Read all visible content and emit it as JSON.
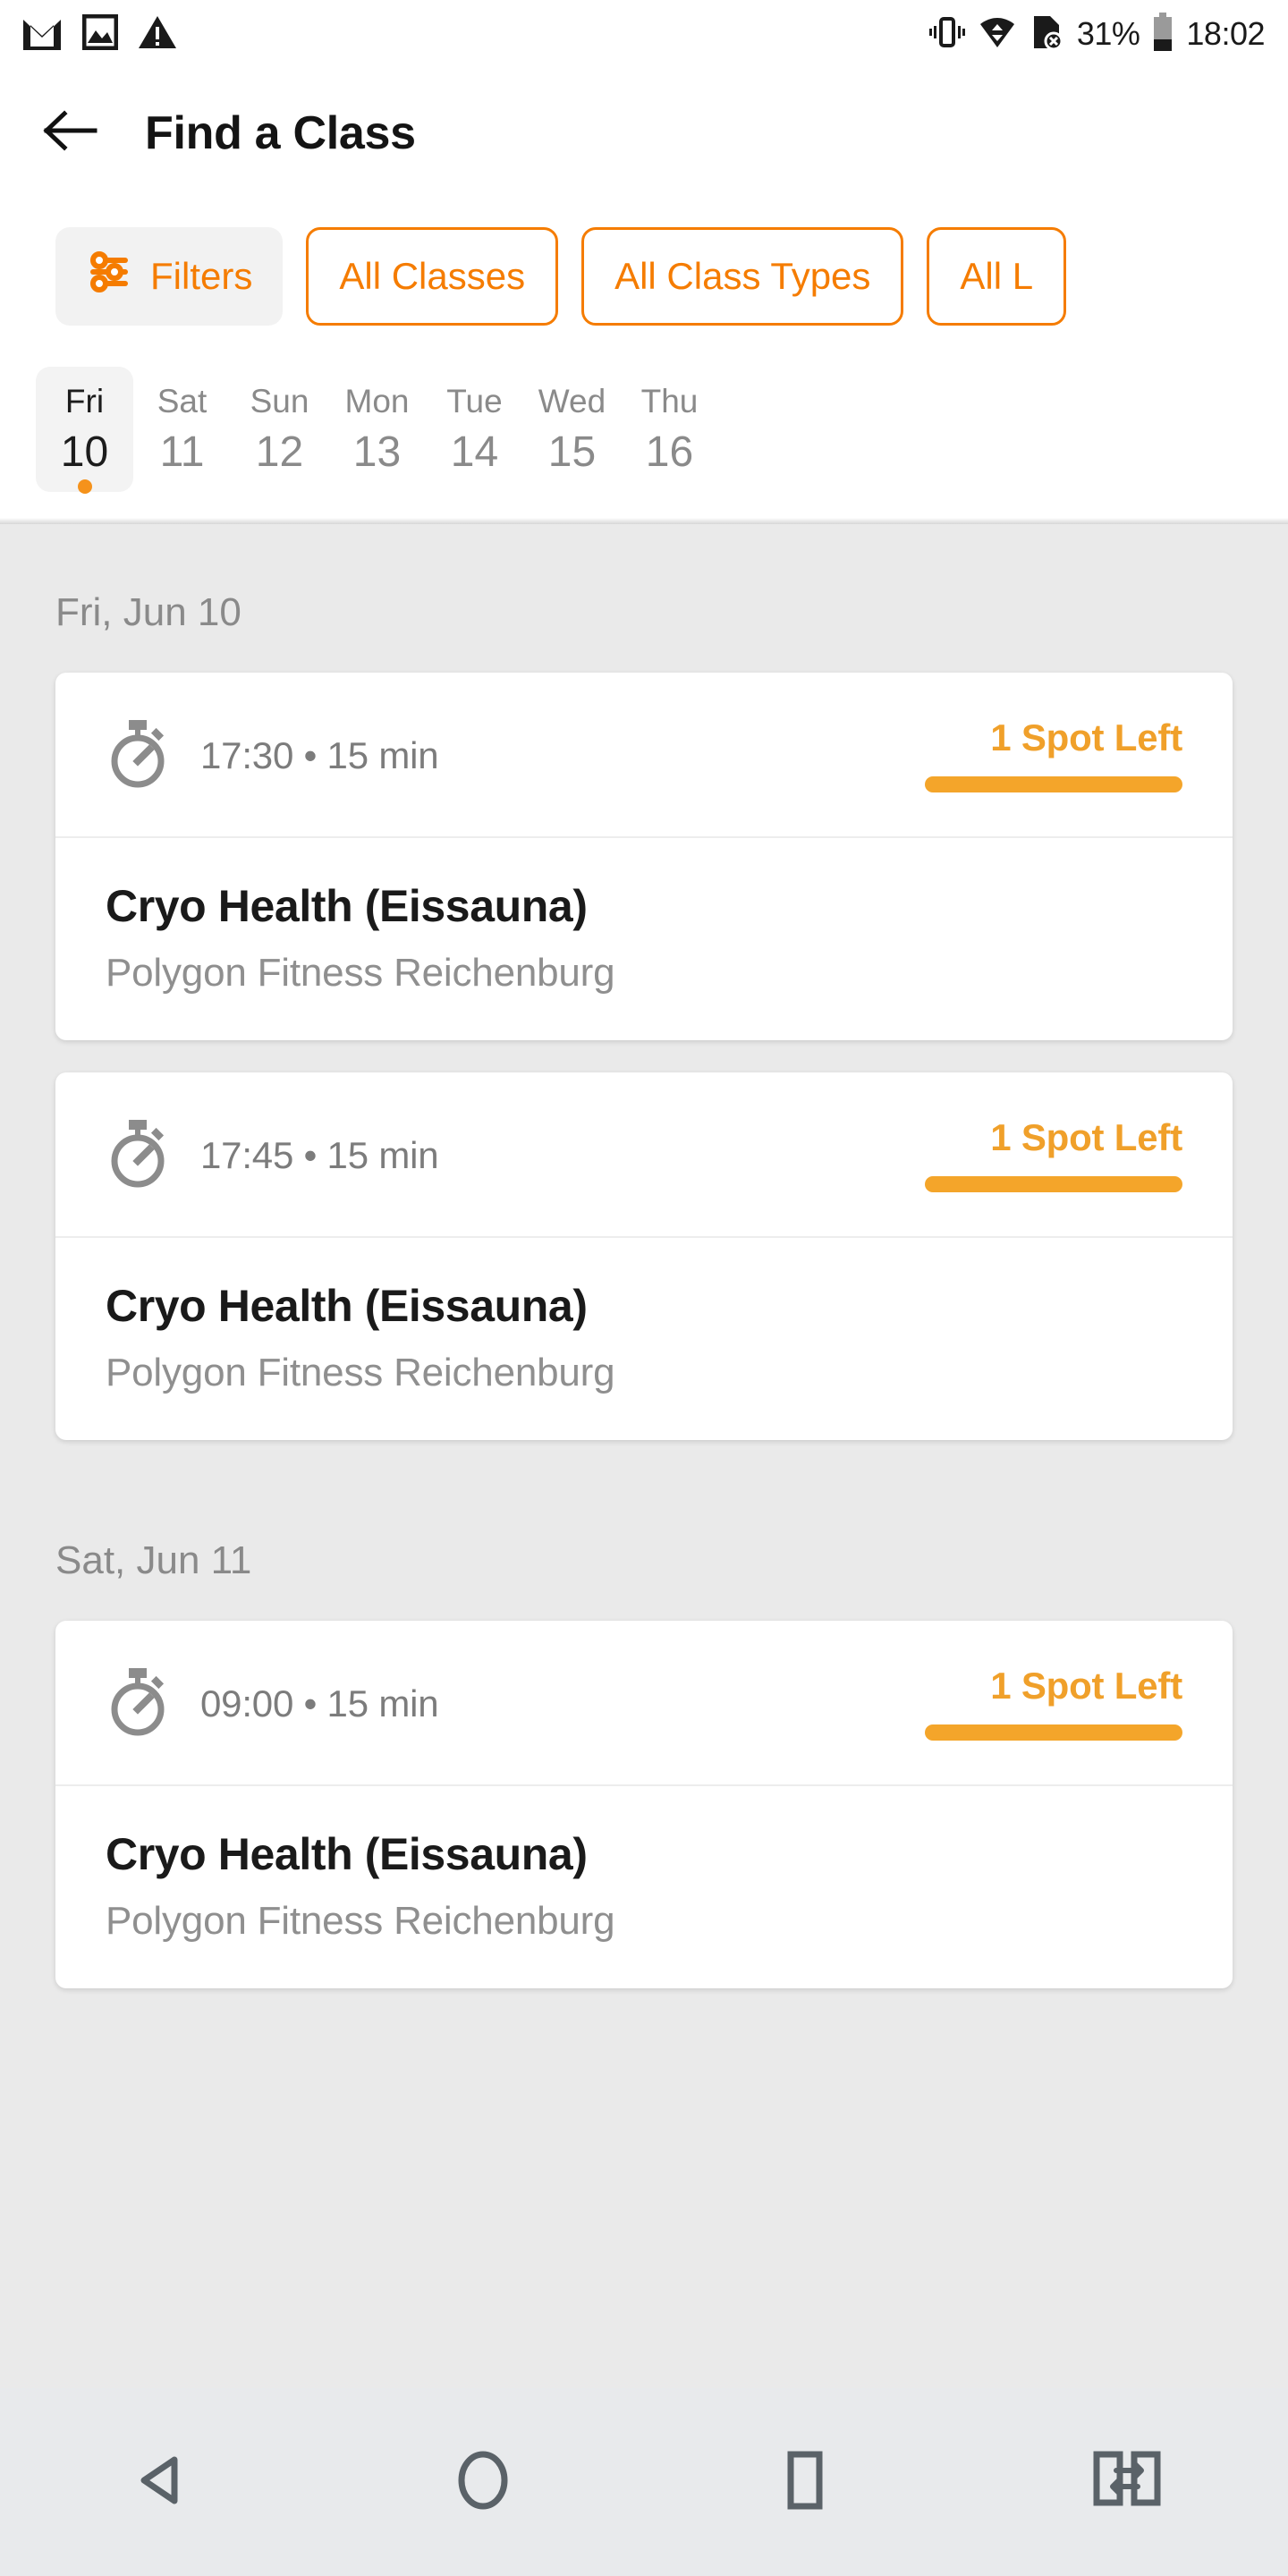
{
  "status_bar": {
    "left_icons": [
      "gmail-icon",
      "photos-icon",
      "warning-triangle-icon"
    ],
    "right_icons": [
      "vibrate-icon",
      "wifi-icon",
      "sim-card-off-icon",
      "battery-icon"
    ],
    "battery_percent": "31%",
    "clock": "18:02"
  },
  "app_bar": {
    "back_icon": "arrow-back-icon",
    "title": "Find a Class"
  },
  "filters": {
    "filters_chip_label": "Filters",
    "filters_icon": "sliders-icon",
    "chips": [
      {
        "label": "All Classes"
      },
      {
        "label": "All Class Types"
      },
      {
        "label": "All L"
      }
    ]
  },
  "day_strip": {
    "days": [
      {
        "name": "Fri",
        "num": "10",
        "selected": true
      },
      {
        "name": "Sat",
        "num": "11",
        "selected": false
      },
      {
        "name": "Sun",
        "num": "12",
        "selected": false
      },
      {
        "name": "Mon",
        "num": "13",
        "selected": false
      },
      {
        "name": "Tue",
        "num": "14",
        "selected": false
      },
      {
        "name": "Wed",
        "num": "15",
        "selected": false
      },
      {
        "name": "Thu",
        "num": "16",
        "selected": false
      }
    ]
  },
  "sections": [
    {
      "heading": "Fri, Jun 10",
      "classes": [
        {
          "time": "17:30 • 15 min",
          "spots": "1 Spot Left",
          "title": "Cryo Health (Eissauna)",
          "venue": "Polygon Fitness Reichenburg"
        },
        {
          "time": "17:45 • 15 min",
          "spots": "1 Spot Left",
          "title": "Cryo Health (Eissauna)",
          "venue": "Polygon Fitness Reichenburg"
        }
      ]
    },
    {
      "heading": "Sat, Jun 11",
      "classes": [
        {
          "time": "09:00 • 15 min",
          "spots": "1 Spot Left",
          "title": "Cryo Health (Eissauna)",
          "venue": "Polygon Fitness Reichenburg"
        }
      ]
    }
  ],
  "nav_bar": {
    "buttons": [
      "back-triangle-icon",
      "home-circle-icon",
      "recents-square-icon",
      "screen-switch-icon"
    ]
  },
  "colors": {
    "accent_orange": "#f57c00",
    "spots_amber": "#f4a52a",
    "page_bg": "#eaeaea",
    "card_bg": "#ffffff",
    "muted_text": "#8a8a8a",
    "nav_bg": "#e8eaec"
  }
}
